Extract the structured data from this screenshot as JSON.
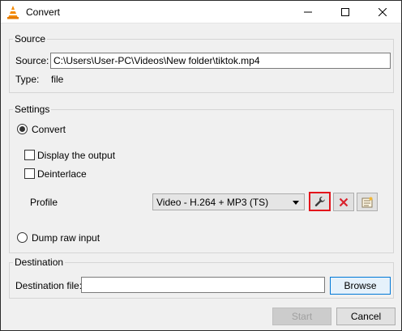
{
  "window": {
    "title": "Convert",
    "controls": [
      "minimize-icon",
      "maximize-icon",
      "close-icon"
    ]
  },
  "source": {
    "group_label": "Source",
    "source_label": "Source:",
    "source_value": "C:\\Users\\User-PC\\Videos\\New folder\\tiktok.mp4",
    "type_label": "Type:",
    "type_value": "file"
  },
  "settings": {
    "group_label": "Settings",
    "convert_label": "Convert",
    "convert_selected": true,
    "display_output_label": "Display the output",
    "display_output_checked": false,
    "deinterlace_label": "Deinterlace",
    "deinterlace_checked": false,
    "profile_label": "Profile",
    "profile_value": "Video - H.264 + MP3 (TS)",
    "profile_buttons": [
      "wrench-icon",
      "delete-icon",
      "new-profile-icon"
    ],
    "dump_raw_label": "Dump raw input",
    "dump_raw_selected": false
  },
  "destination": {
    "group_label": "Destination",
    "file_label": "Destination file:",
    "file_value": "",
    "browse_label": "Browse"
  },
  "footer": {
    "start_label": "Start",
    "cancel_label": "Cancel"
  },
  "colors": {
    "highlight_border": "#e3141b",
    "delete_red": "#d9232d",
    "vlc_orange": "#f48a00"
  }
}
